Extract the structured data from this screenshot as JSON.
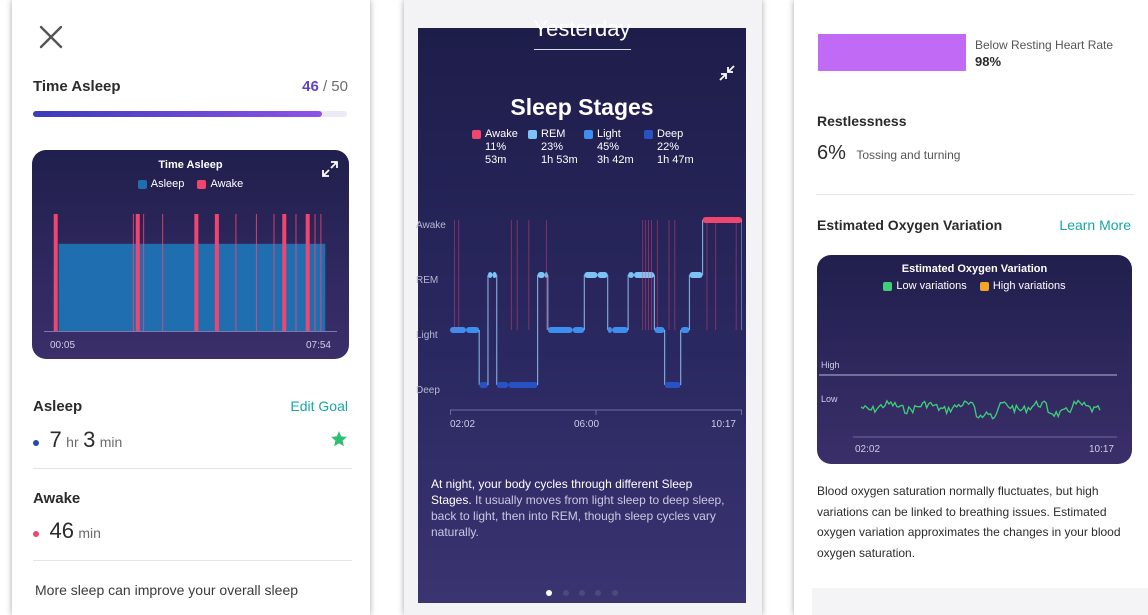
{
  "screen1": {
    "time_asleep": {
      "label": "Time Asleep",
      "score": "46",
      "max": "/ 50",
      "progress": 0.92
    },
    "chart": {
      "title": "Time Asleep",
      "legend": [
        {
          "name": "Asleep",
          "color": "#1f6fb0"
        },
        {
          "name": "Awake",
          "color": "#f0456f"
        }
      ],
      "start": "00:05",
      "end": "07:54"
    },
    "asleep": {
      "label": "Asleep",
      "edit": "Edit Goal",
      "hours": "7",
      "hr_unit": "hr",
      "minutes": "3",
      "min_unit": "min"
    },
    "awake": {
      "label": "Awake",
      "minutes": "46",
      "min_unit": "min"
    },
    "footer_text": "More sleep can improve your overall sleep"
  },
  "screen2": {
    "header": "Yesterday",
    "title": "Sleep Stages",
    "legend": [
      {
        "name": "Awake",
        "pct": "11%",
        "time": "53m",
        "color": "#f0456f"
      },
      {
        "name": "REM",
        "pct": "23%",
        "time": "1h 53m",
        "color": "#7cc4f5"
      },
      {
        "name": "Light",
        "pct": "45%",
        "time": "3h 42m",
        "color": "#3e8ef0"
      },
      {
        "name": "Deep",
        "pct": "22%",
        "time": "1h 47m",
        "color": "#2752c4"
      }
    ],
    "levels": [
      "Awake",
      "REM",
      "Light",
      "Deep"
    ],
    "ticks": [
      "02:02",
      "06:00",
      "10:17"
    ],
    "desc_bold": "At night, your body cycles through different Sleep Stages.",
    "desc_rest": " It usually moves from light sleep to deep sleep, back to light, then into REM, though sleep cycles vary naturally."
  },
  "screen3": {
    "heart": {
      "label": "Below Resting Heart Rate",
      "value": "98%",
      "color": "#c06af5"
    },
    "restlessness": {
      "label": "Restlessness",
      "value": "6%",
      "desc": "Tossing and turning"
    },
    "oxygen": {
      "label": "Estimated Oxygen Variation",
      "link": "Learn More",
      "chart_title": "Estimated Oxygen Variation",
      "legend": [
        {
          "name": "Low variations",
          "color": "#3fcf7a"
        },
        {
          "name": "High variations",
          "color": "#f5a623"
        }
      ],
      "high": "High",
      "low": "Low",
      "start": "02:02",
      "end": "10:17",
      "desc": "Blood oxygen saturation normally fluctuates, but high variations can be linked to breathing issues. Estimated oxygen variation approximates the changes in your blood oxygen saturation."
    }
  },
  "chart_data": [
    {
      "type": "bar",
      "title": "Time Asleep",
      "x_range": [
        "00:05",
        "07:54"
      ],
      "series": [
        {
          "name": "Asleep",
          "values": [
            [
              0.05,
              0.96
            ]
          ]
        },
        {
          "name": "Awake",
          "values": [
            0.04,
            0.32,
            0.52,
            0.59,
            0.82,
            0.9,
            0.305,
            0.34,
            0.405,
            0.59,
            0.655,
            0.725,
            0.785,
            0.86,
            0.925,
            0.945
          ]
        }
      ]
    },
    {
      "type": "line",
      "title": "Sleep Stages",
      "x_range": [
        "02:02",
        "10:17"
      ],
      "levels": [
        "Awake",
        "REM",
        "Light",
        "Deep"
      ],
      "x": [
        0.0,
        0.055,
        0.1,
        0.13,
        0.145,
        0.16,
        0.2,
        0.3,
        0.325,
        0.335,
        0.42,
        0.46,
        0.505,
        0.54,
        0.555,
        0.61,
        0.63,
        0.7,
        0.735,
        0.79,
        0.82,
        0.865,
        1.0
      ],
      "y": [
        2,
        2,
        3,
        1,
        1,
        3,
        3,
        1,
        1,
        2,
        2,
        1,
        1,
        2,
        2,
        1,
        1,
        2,
        3,
        2,
        1,
        0,
        2
      ]
    },
    {
      "type": "line",
      "title": "Estimated Oxygen Variation",
      "x_range": [
        "02:02",
        "10:17"
      ],
      "y_labels": [
        "High",
        "Low"
      ],
      "series": [
        {
          "name": "Low variations"
        }
      ]
    }
  ]
}
